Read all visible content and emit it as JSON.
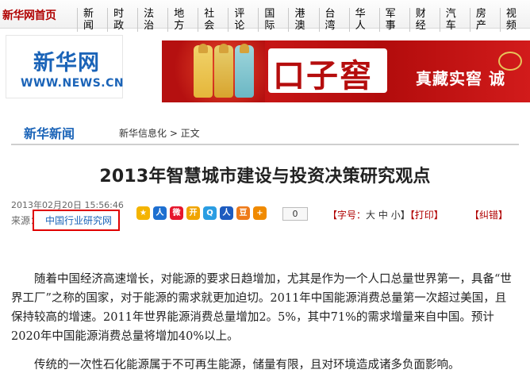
{
  "topnav": {
    "home": "新华网首页",
    "items": [
      "新闻",
      "时政",
      "法治",
      "地方",
      "社会",
      "评论",
      "国际",
      "港澳",
      "台湾",
      "华人",
      "军事",
      "财经",
      "汽车",
      "房产",
      "视频"
    ]
  },
  "logo": {
    "cn": "新华网",
    "en": "WWW.NEWS.CN"
  },
  "banner": {
    "brand": "口子窖",
    "slogan": "真藏实窖  诚"
  },
  "section": {
    "title": "新华新闻",
    "breadcrumb": "新华信息化 > 正文"
  },
  "article": {
    "title": "2013年智慧城市建设与投资决策研究观点",
    "date": "2013年02月20日 15:56:46",
    "source_label": "来源：",
    "source": "中国行业研究网",
    "share_count": "0",
    "tools": {
      "font_label": "【字号：",
      "large": "大",
      "medium": "中",
      "small": "小】",
      "print": "【打印】",
      "correct": "【纠错】"
    },
    "paragraphs": [
      "随着中国经济高速增长，对能源的要求日趋增加，尤其是作为一个人口总量世界第一，具备“世界工厂”之称的国家，对于能源的需求就更加迫切。2011年中国能源消费总量第一次超过美国，且保持较高的增速。2011年世界能源消费总量增加2。5%，其中71%的需求增量来自中国。预计2020年中国能源消费总量将增加40%以上。",
      "传统的一次性石化能源属于不可再生能源，储量有限，且对环境造成诸多负面影响。"
    ]
  },
  "colors": {
    "brand_red": "#b00000",
    "link_blue": "#1b64b8",
    "highlight_box": "#e00000"
  },
  "share_icons": [
    "qzone-icon",
    "renren-icon",
    "weibo-icon",
    "kaixin-icon",
    "tencent-weibo-icon",
    "renmin-icon",
    "douban-icon",
    "more-icon"
  ]
}
